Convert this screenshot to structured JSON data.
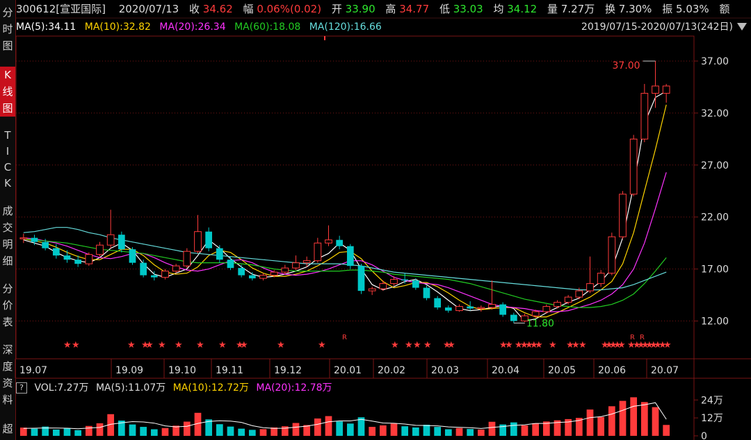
{
  "sidebar": {
    "tabs": [
      {
        "label": "分时图",
        "active": false
      },
      {
        "label": "K线图",
        "active": true
      },
      {
        "label": "TICK",
        "active": false
      },
      {
        "label": "成交明细",
        "active": false
      },
      {
        "label": "分价表",
        "active": false
      },
      {
        "label": "深度资料",
        "active": false
      },
      {
        "label": "超",
        "active": false
      }
    ]
  },
  "quote": {
    "code_name": "300612[宣亚国际]",
    "date": "2020/07/13",
    "close_label": "收",
    "close": "34.62",
    "change_label": "幅",
    "change": "0.06%(0.02)",
    "open_label": "开",
    "open": "33.90",
    "high_label": "高",
    "high": "34.77",
    "low_label": "低",
    "low": "33.03",
    "avg_label": "均",
    "avg": "34.12",
    "vol_label": "量",
    "vol": "7.27万",
    "turnover_label": "换",
    "turnover": "7.30%",
    "amp_label": "振",
    "amp": "5.03%",
    "amount_label": "额"
  },
  "ma": {
    "ma5": "MA(5):34.11",
    "ma10": "MA(10):32.82",
    "ma20": "MA(20):26.34",
    "ma60": "MA(60):18.08",
    "ma120": "MA(120):16.66",
    "range": "2019/07/15-2020/07/13(242日)"
  },
  "colors": {
    "up": "#ff3b3b",
    "down": "#00c8c8",
    "ma5": "#ffffff",
    "ma10": "#ffd400",
    "ma20": "#ff33ff",
    "ma60": "#22cc22",
    "ma120": "#66dddd",
    "grid": "#7a1515"
  },
  "volume": {
    "vol": "VOL:7.27万",
    "ma5": "MA(5):11.07万",
    "ma10": "MA(10):12.72万",
    "ma20": "MA(20):12.78万",
    "axis": [
      "24万",
      "12万",
      "0"
    ]
  },
  "chart_data": {
    "type": "candlestick",
    "y_ticks": [
      "37.00",
      "32.00",
      "27.00",
      "22.00",
      "17.00",
      "12.00"
    ],
    "ylim": [
      8.5,
      39.0
    ],
    "x_ticks": [
      "19.07",
      "19.09",
      "19.10",
      "19.11",
      "19.12",
      "20.01",
      "20.02",
      "20.03",
      "20.04",
      "20.05",
      "20.06",
      "20.07"
    ],
    "annotations": {
      "max": "37.00",
      "min": "11.80"
    },
    "marker_symbol": "★",
    "marker_r": "R",
    "series": [
      {
        "name": "MA(5)",
        "values": [
          19.8,
          19.5,
          19.2,
          18.6,
          18.1,
          17.8,
          17.6,
          18.1,
          19.0,
          19.5,
          18.8,
          17.5,
          16.5,
          16.2,
          16.6,
          17.0,
          18.3,
          19.8,
          19.0,
          18.0,
          17.2,
          16.5,
          16.2,
          16.3,
          16.5,
          16.8,
          17.2,
          18.0,
          18.5,
          19.5,
          18.8,
          17.0,
          15.5,
          15.0,
          15.3,
          15.8,
          16.0,
          15.5,
          14.8,
          14.0,
          13.2,
          13.0,
          13.1,
          13.3,
          13.5,
          13.2,
          12.0,
          12.2,
          12.8,
          13.3,
          13.8,
          14.2,
          15.0,
          15.8,
          17.0,
          20.0,
          25.0,
          31.0,
          33.5,
          34.1
        ]
      },
      {
        "name": "MA(10)",
        "values": [
          19.9,
          19.7,
          19.5,
          19.1,
          18.6,
          18.2,
          17.9,
          17.9,
          18.4,
          18.9,
          18.9,
          18.3,
          17.4,
          16.7,
          16.5,
          16.6,
          17.2,
          18.3,
          18.8,
          18.6,
          17.9,
          17.1,
          16.6,
          16.3,
          16.3,
          16.5,
          16.8,
          17.3,
          17.9,
          18.6,
          18.7,
          18.0,
          16.8,
          15.8,
          15.2,
          15.4,
          15.7,
          15.7,
          15.3,
          14.7,
          14.0,
          13.4,
          13.1,
          13.2,
          13.3,
          13.3,
          12.8,
          12.4,
          12.4,
          12.8,
          13.3,
          13.8,
          14.3,
          15.0,
          15.8,
          17.5,
          20.5,
          24.5,
          28.5,
          32.8
        ]
      },
      {
        "name": "MA(20)",
        "values": [
          20.0,
          19.9,
          19.7,
          19.5,
          19.2,
          18.8,
          18.4,
          18.1,
          18.0,
          18.2,
          18.5,
          18.5,
          18.1,
          17.6,
          17.2,
          16.9,
          16.8,
          17.0,
          17.4,
          17.8,
          17.9,
          17.6,
          17.1,
          16.7,
          16.5,
          16.4,
          16.5,
          16.7,
          17.0,
          17.4,
          17.8,
          17.8,
          17.4,
          16.8,
          16.2,
          15.9,
          15.7,
          15.6,
          15.5,
          15.2,
          14.8,
          14.4,
          14.0,
          13.6,
          13.4,
          13.3,
          13.2,
          13.0,
          12.9,
          12.9,
          13.0,
          13.3,
          13.6,
          14.0,
          14.6,
          15.5,
          17.0,
          19.5,
          22.8,
          26.3
        ]
      },
      {
        "name": "MA(60)",
        "values": [
          19.9,
          19.8,
          19.7,
          19.6,
          19.5,
          19.3,
          19.1,
          18.9,
          18.8,
          18.7,
          18.6,
          18.5,
          18.3,
          18.1,
          17.9,
          17.7,
          17.6,
          17.6,
          17.6,
          17.6,
          17.5,
          17.4,
          17.2,
          17.0,
          16.9,
          16.8,
          16.8,
          16.8,
          16.8,
          16.8,
          16.9,
          16.9,
          16.8,
          16.7,
          16.5,
          16.4,
          16.3,
          16.2,
          16.1,
          16.0,
          15.8,
          15.6,
          15.3,
          15.0,
          14.7,
          14.4,
          14.1,
          13.9,
          13.7,
          13.5,
          13.4,
          13.3,
          13.3,
          13.4,
          13.6,
          14.0,
          14.6,
          15.6,
          16.8,
          18.1
        ]
      },
      {
        "name": "MA(120)",
        "values": [
          20.5,
          20.6,
          20.8,
          21.0,
          21.0,
          20.8,
          20.5,
          20.3,
          20.0,
          19.8,
          19.6,
          19.4,
          19.2,
          19.0,
          18.8,
          18.6,
          18.5,
          18.4,
          18.3,
          18.2,
          18.1,
          18.0,
          17.9,
          17.8,
          17.7,
          17.6,
          17.5,
          17.5,
          17.5,
          17.5,
          17.4,
          17.3,
          17.1,
          16.9,
          16.7,
          16.6,
          16.5,
          16.4,
          16.3,
          16.2,
          16.1,
          16.0,
          15.9,
          15.8,
          15.7,
          15.6,
          15.5,
          15.4,
          15.3,
          15.2,
          15.1,
          15.0,
          15.0,
          15.0,
          15.1,
          15.2,
          15.5,
          15.9,
          16.3,
          16.7
        ]
      }
    ],
    "candles": [
      [
        19.9,
        20.4,
        19.5,
        20.0
      ],
      [
        20.0,
        20.3,
        19.3,
        19.6
      ],
      [
        19.6,
        19.9,
        18.8,
        19.0
      ],
      [
        19.0,
        19.4,
        18.0,
        18.3
      ],
      [
        18.3,
        18.8,
        17.6,
        17.9
      ],
      [
        17.9,
        18.3,
        17.2,
        17.5
      ],
      [
        17.5,
        18.6,
        17.3,
        18.4
      ],
      [
        18.4,
        19.6,
        18.2,
        19.3
      ],
      [
        19.3,
        22.7,
        19.0,
        20.3
      ],
      [
        20.3,
        20.6,
        18.6,
        18.9
      ],
      [
        18.9,
        19.1,
        17.4,
        17.6
      ],
      [
        17.6,
        17.9,
        16.2,
        16.4
      ],
      [
        16.4,
        16.8,
        15.9,
        16.2
      ],
      [
        16.2,
        17.0,
        16.0,
        16.8
      ],
      [
        16.8,
        17.5,
        16.6,
        17.3
      ],
      [
        17.3,
        19.0,
        17.1,
        18.7
      ],
      [
        18.7,
        22.2,
        18.5,
        20.6
      ],
      [
        20.6,
        21.0,
        18.7,
        19.0
      ],
      [
        19.0,
        19.3,
        17.6,
        17.9
      ],
      [
        17.9,
        18.2,
        16.9,
        17.1
      ],
      [
        17.1,
        17.4,
        16.2,
        16.4
      ],
      [
        16.4,
        16.7,
        15.9,
        16.1
      ],
      [
        16.1,
        16.6,
        15.9,
        16.4
      ],
      [
        16.4,
        16.9,
        16.2,
        16.7
      ],
      [
        16.7,
        17.4,
        16.5,
        17.1
      ],
      [
        17.1,
        18.3,
        16.9,
        17.6
      ],
      [
        17.6,
        18.2,
        17.2,
        17.8
      ],
      [
        17.8,
        20.0,
        17.6,
        19.5
      ],
      [
        19.5,
        21.2,
        19.2,
        19.8
      ],
      [
        19.8,
        20.2,
        18.9,
        19.2
      ],
      [
        19.2,
        19.4,
        17.0,
        17.3
      ],
      [
        17.3,
        17.5,
        14.6,
        14.9
      ],
      [
        14.9,
        15.3,
        14.5,
        15.1
      ],
      [
        15.1,
        15.9,
        14.9,
        15.6
      ],
      [
        15.6,
        16.3,
        15.4,
        16.0
      ],
      [
        16.0,
        16.6,
        15.6,
        15.9
      ],
      [
        15.9,
        16.1,
        15.0,
        15.2
      ],
      [
        15.2,
        15.4,
        14.0,
        14.2
      ],
      [
        14.2,
        14.4,
        13.1,
        13.3
      ],
      [
        13.3,
        13.5,
        12.8,
        13.0
      ],
      [
        13.0,
        13.6,
        12.9,
        13.4
      ],
      [
        13.4,
        13.9,
        13.0,
        13.2
      ],
      [
        13.2,
        13.5,
        12.9,
        13.3
      ],
      [
        13.3,
        15.9,
        13.1,
        13.6
      ],
      [
        13.6,
        13.8,
        12.4,
        12.6
      ],
      [
        12.6,
        12.8,
        11.8,
        12.0
      ],
      [
        12.0,
        12.7,
        11.9,
        12.5
      ],
      [
        12.5,
        13.1,
        12.3,
        12.9
      ],
      [
        12.9,
        13.6,
        12.7,
        13.4
      ],
      [
        13.4,
        14.0,
        13.2,
        13.8
      ],
      [
        13.8,
        14.5,
        13.6,
        14.3
      ],
      [
        14.3,
        15.2,
        14.1,
        14.9
      ],
      [
        14.9,
        18.2,
        14.7,
        15.6
      ],
      [
        15.6,
        16.9,
        15.3,
        16.6
      ],
      [
        16.6,
        20.5,
        16.4,
        20.1
      ],
      [
        20.1,
        24.5,
        19.9,
        24.2
      ],
      [
        24.2,
        29.9,
        24.0,
        29.5
      ],
      [
        29.5,
        34.8,
        29.2,
        33.9
      ],
      [
        33.9,
        37.0,
        32.5,
        34.6
      ],
      [
        33.9,
        34.8,
        33.0,
        34.6
      ]
    ],
    "volumes": [
      5.5,
      4.8,
      6.2,
      4.2,
      5.0,
      3.8,
      6.6,
      8.4,
      14.5,
      10.2,
      7.6,
      6.0,
      4.4,
      5.2,
      6.8,
      9.5,
      15.4,
      11.0,
      7.8,
      6.2,
      4.8,
      4.0,
      4.5,
      5.6,
      6.4,
      8.6,
      7.2,
      11.6,
      13.2,
      9.6,
      8.2,
      12.4,
      6.0,
      7.0,
      8.2,
      6.4,
      5.6,
      7.4,
      6.0,
      4.4,
      5.2,
      4.6,
      4.2,
      9.4,
      7.6,
      9.0,
      7.0,
      8.4,
      9.6,
      10.4,
      11.2,
      12.0,
      17.6,
      12.6,
      19.8,
      23.4,
      25.8,
      22.6,
      19.2,
      7.3
    ],
    "vol_ma5": [
      5.0,
      5.1,
      5.3,
      5.2,
      5.1,
      4.8,
      5.2,
      5.6,
      7.7,
      8.7,
      9.5,
      9.3,
      8.5,
      6.7,
      6.0,
      6.4,
      8.3,
      9.6,
      10.1,
      9.9,
      9.0,
      6.8,
      5.5,
      5.0,
      5.1,
      5.8,
      6.5,
      7.7,
      9.4,
      10.0,
      10.0,
      11.0,
      9.9,
      8.6,
      8.4,
      7.9,
      7.0,
      6.9,
      6.7,
      6.0,
      5.7,
      5.5,
      4.9,
      5.6,
      6.2,
      7.0,
      7.4,
      8.3,
      8.3,
      8.9,
      9.3,
      10.3,
      12.2,
      12.8,
      14.6,
      17.1,
      19.8,
      20.8,
      22.2,
      11.1
    ]
  }
}
